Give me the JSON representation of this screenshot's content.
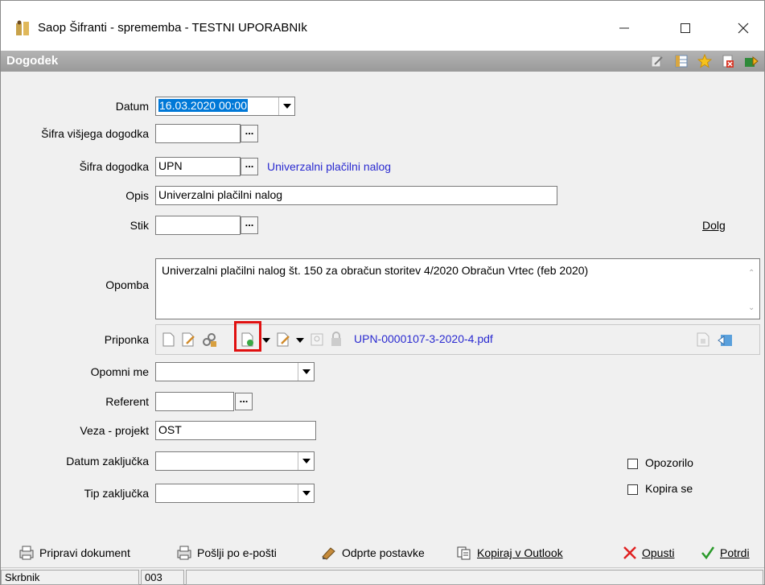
{
  "window": {
    "title": "Saop Šifranti - sprememba - TESTNI UPORABNIk"
  },
  "header": {
    "title": "Dogodek"
  },
  "form": {
    "datum": {
      "label": "Datum",
      "value": "16.03.2020 00:00"
    },
    "sifra_visjega": {
      "label": "Šifra višjega dogodka",
      "value": ""
    },
    "sifra_dogodka": {
      "label": "Šifra dogodka",
      "value": "UPN",
      "link": "Univerzalni plačilni nalog"
    },
    "opis": {
      "label": "Opis",
      "value": "Univerzalni plačilni nalog"
    },
    "stik": {
      "label": "Stik",
      "value": ""
    },
    "dolg_label": "Dolg",
    "opomba": {
      "label": "Opomba",
      "value": "Univerzalni plačilni nalog št. 150 za obračun storitev 4/2020 Obračun Vrtec (feb 2020)"
    },
    "priponka": {
      "label": "Priponka",
      "file": "UPN-0000107-3-2020-4.pdf"
    },
    "opomni_me": {
      "label": "Opomni me",
      "value": ""
    },
    "referent": {
      "label": "Referent",
      "value": ""
    },
    "veza_projekt": {
      "label": "Veza - projekt",
      "value": "OST"
    },
    "datum_zakljucka": {
      "label": "Datum zaključka",
      "value": ""
    },
    "tip_zakljucka": {
      "label": "Tip zaključka",
      "value": ""
    },
    "opozorilo": {
      "label": "Opozorilo",
      "checked": false
    },
    "kopira_se": {
      "label": "Kopira se",
      "checked": false
    }
  },
  "toolbar": {
    "pripravi": "Pripravi dokument",
    "poslji": "Pošlji po e-pošti",
    "odprte": "Odprte postavke",
    "kopiraj": "Kopiraj v Outlook",
    "opusti": "Opusti",
    "potrdi": "Potrdi"
  },
  "status": {
    "label": "Skrbnik",
    "value": "003"
  }
}
